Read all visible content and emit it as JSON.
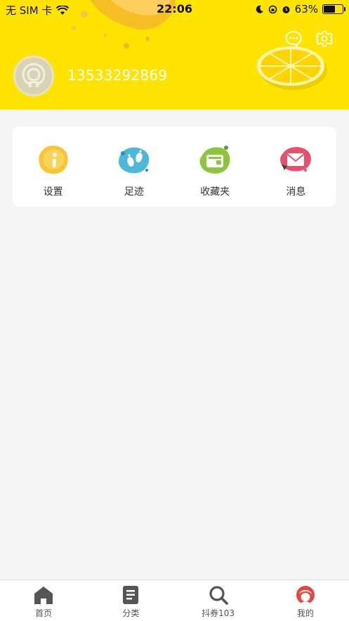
{
  "status_bar": {
    "carrier": "无 SIM 卡",
    "time": "22:06",
    "battery": "63%",
    "battery_level": 0.63
  },
  "header": {
    "username": "13533292869",
    "bg_color": "#ffe400",
    "icons": [
      "message-icon",
      "settings-gear-icon"
    ]
  },
  "menu": {
    "items": [
      {
        "label": "设置",
        "icon": "info-icon",
        "color": "#f9c537"
      },
      {
        "label": "足迹",
        "icon": "footprint-icon",
        "color": "#4fb8d8"
      },
      {
        "label": "收藏夹",
        "icon": "wallet-icon",
        "color": "#8cc63f"
      },
      {
        "label": "消息",
        "icon": "envelope-icon",
        "color": "#e7506c"
      }
    ]
  },
  "tabbar": {
    "items": [
      {
        "label": "首页",
        "icon": "home-icon"
      },
      {
        "label": "分类",
        "icon": "list-icon"
      },
      {
        "label": "抖券103",
        "icon": "search-icon"
      },
      {
        "label": "我的",
        "icon": "profile-icon",
        "active": true
      }
    ]
  }
}
